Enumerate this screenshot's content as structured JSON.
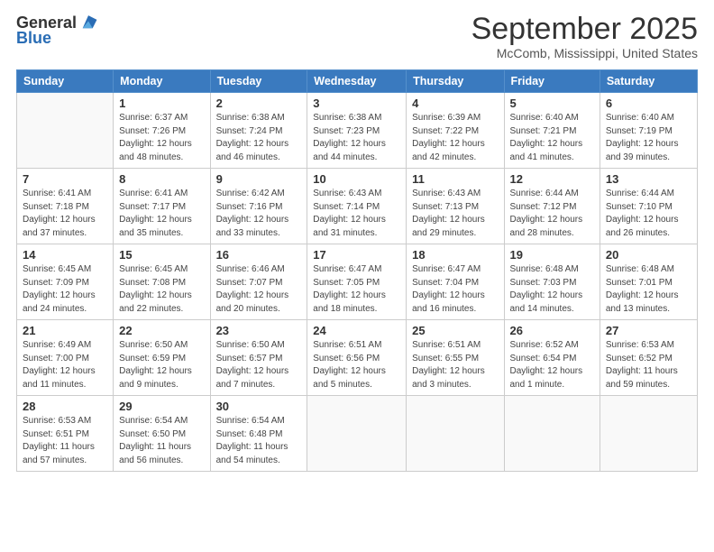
{
  "header": {
    "logo_general": "General",
    "logo_blue": "Blue",
    "month_title": "September 2025",
    "location": "McComb, Mississippi, United States"
  },
  "days_of_week": [
    "Sunday",
    "Monday",
    "Tuesday",
    "Wednesday",
    "Thursday",
    "Friday",
    "Saturday"
  ],
  "weeks": [
    [
      {
        "day": "",
        "info": ""
      },
      {
        "day": "1",
        "info": "Sunrise: 6:37 AM\nSunset: 7:26 PM\nDaylight: 12 hours\nand 48 minutes."
      },
      {
        "day": "2",
        "info": "Sunrise: 6:38 AM\nSunset: 7:24 PM\nDaylight: 12 hours\nand 46 minutes."
      },
      {
        "day": "3",
        "info": "Sunrise: 6:38 AM\nSunset: 7:23 PM\nDaylight: 12 hours\nand 44 minutes."
      },
      {
        "day": "4",
        "info": "Sunrise: 6:39 AM\nSunset: 7:22 PM\nDaylight: 12 hours\nand 42 minutes."
      },
      {
        "day": "5",
        "info": "Sunrise: 6:40 AM\nSunset: 7:21 PM\nDaylight: 12 hours\nand 41 minutes."
      },
      {
        "day": "6",
        "info": "Sunrise: 6:40 AM\nSunset: 7:19 PM\nDaylight: 12 hours\nand 39 minutes."
      }
    ],
    [
      {
        "day": "7",
        "info": "Sunrise: 6:41 AM\nSunset: 7:18 PM\nDaylight: 12 hours\nand 37 minutes."
      },
      {
        "day": "8",
        "info": "Sunrise: 6:41 AM\nSunset: 7:17 PM\nDaylight: 12 hours\nand 35 minutes."
      },
      {
        "day": "9",
        "info": "Sunrise: 6:42 AM\nSunset: 7:16 PM\nDaylight: 12 hours\nand 33 minutes."
      },
      {
        "day": "10",
        "info": "Sunrise: 6:43 AM\nSunset: 7:14 PM\nDaylight: 12 hours\nand 31 minutes."
      },
      {
        "day": "11",
        "info": "Sunrise: 6:43 AM\nSunset: 7:13 PM\nDaylight: 12 hours\nand 29 minutes."
      },
      {
        "day": "12",
        "info": "Sunrise: 6:44 AM\nSunset: 7:12 PM\nDaylight: 12 hours\nand 28 minutes."
      },
      {
        "day": "13",
        "info": "Sunrise: 6:44 AM\nSunset: 7:10 PM\nDaylight: 12 hours\nand 26 minutes."
      }
    ],
    [
      {
        "day": "14",
        "info": "Sunrise: 6:45 AM\nSunset: 7:09 PM\nDaylight: 12 hours\nand 24 minutes."
      },
      {
        "day": "15",
        "info": "Sunrise: 6:45 AM\nSunset: 7:08 PM\nDaylight: 12 hours\nand 22 minutes."
      },
      {
        "day": "16",
        "info": "Sunrise: 6:46 AM\nSunset: 7:07 PM\nDaylight: 12 hours\nand 20 minutes."
      },
      {
        "day": "17",
        "info": "Sunrise: 6:47 AM\nSunset: 7:05 PM\nDaylight: 12 hours\nand 18 minutes."
      },
      {
        "day": "18",
        "info": "Sunrise: 6:47 AM\nSunset: 7:04 PM\nDaylight: 12 hours\nand 16 minutes."
      },
      {
        "day": "19",
        "info": "Sunrise: 6:48 AM\nSunset: 7:03 PM\nDaylight: 12 hours\nand 14 minutes."
      },
      {
        "day": "20",
        "info": "Sunrise: 6:48 AM\nSunset: 7:01 PM\nDaylight: 12 hours\nand 13 minutes."
      }
    ],
    [
      {
        "day": "21",
        "info": "Sunrise: 6:49 AM\nSunset: 7:00 PM\nDaylight: 12 hours\nand 11 minutes."
      },
      {
        "day": "22",
        "info": "Sunrise: 6:50 AM\nSunset: 6:59 PM\nDaylight: 12 hours\nand 9 minutes."
      },
      {
        "day": "23",
        "info": "Sunrise: 6:50 AM\nSunset: 6:57 PM\nDaylight: 12 hours\nand 7 minutes."
      },
      {
        "day": "24",
        "info": "Sunrise: 6:51 AM\nSunset: 6:56 PM\nDaylight: 12 hours\nand 5 minutes."
      },
      {
        "day": "25",
        "info": "Sunrise: 6:51 AM\nSunset: 6:55 PM\nDaylight: 12 hours\nand 3 minutes."
      },
      {
        "day": "26",
        "info": "Sunrise: 6:52 AM\nSunset: 6:54 PM\nDaylight: 12 hours\nand 1 minute."
      },
      {
        "day": "27",
        "info": "Sunrise: 6:53 AM\nSunset: 6:52 PM\nDaylight: 11 hours\nand 59 minutes."
      }
    ],
    [
      {
        "day": "28",
        "info": "Sunrise: 6:53 AM\nSunset: 6:51 PM\nDaylight: 11 hours\nand 57 minutes."
      },
      {
        "day": "29",
        "info": "Sunrise: 6:54 AM\nSunset: 6:50 PM\nDaylight: 11 hours\nand 56 minutes."
      },
      {
        "day": "30",
        "info": "Sunrise: 6:54 AM\nSunset: 6:48 PM\nDaylight: 11 hours\nand 54 minutes."
      },
      {
        "day": "",
        "info": ""
      },
      {
        "day": "",
        "info": ""
      },
      {
        "day": "",
        "info": ""
      },
      {
        "day": "",
        "info": ""
      }
    ]
  ]
}
